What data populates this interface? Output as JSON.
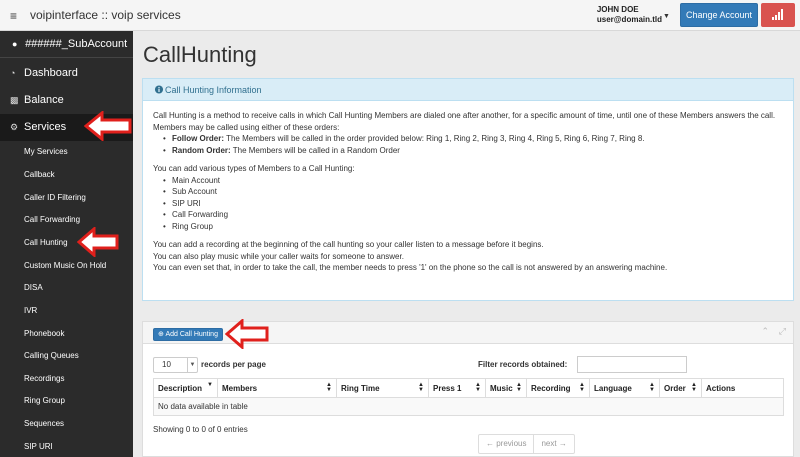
{
  "topbar": {
    "app_title": "voipinterface :: voip services",
    "user_name": "JOHN DOE",
    "user_email": "user@domain.tld",
    "change_account_label": "Change Account"
  },
  "sidebar": {
    "account": "######_SubAccount",
    "main_items": [
      {
        "label": "Dashboard",
        "icon": "dashboard-icon"
      },
      {
        "label": "Balance",
        "icon": "bar-chart-icon"
      },
      {
        "label": "Services",
        "icon": "gear-icon",
        "active": true
      }
    ],
    "sub_items": [
      "My Services",
      "Callback",
      "Caller ID Filtering",
      "Call Forwarding",
      "Call Hunting",
      "Custom Music On Hold",
      "DISA",
      "IVR",
      "Phonebook",
      "Calling Queues",
      "Recordings",
      "Ring Group",
      "Sequences",
      "SIP URI"
    ]
  },
  "main": {
    "page_title": "CallHunting",
    "info_panel": {
      "title": "Call Hunting Information",
      "intro": "Call Hunting is a method to receive calls in which Call Hunting Members are dialed one after another, for a specific amount of time, until one of these Members answers the call.",
      "orders_intro": "Members may be called using either of these orders:",
      "follow_label": "Follow Order:",
      "follow_text": " The Members will be called in the order provided below: Ring 1, Ring 2, Ring 3, Ring 4, Ring 5, Ring 6, Ring 7, Ring 8.",
      "random_label": "Random Order:",
      "random_text": " The Members will be called in a Random Order",
      "types_intro": "You can add various types of Members to a Call Hunting:",
      "types": [
        "Main Account",
        "Sub Account",
        "SIP URI",
        "Call Forwarding",
        "Ring Group"
      ],
      "notes": [
        "You can add a recording at the beginning of the call hunting so your caller listen to a message before it begins.",
        "You can also play music while your caller waits for someone to answer.",
        "You can even set that, in order to take the call, the member needs to press '1' on the phone so the call is not answered by an answering machine."
      ]
    },
    "list_panel": {
      "add_button": "Add Call Hunting",
      "page_length": "10",
      "length_label": "records per page",
      "filter_label": "Filter records obtained:",
      "filter_value": "",
      "columns": [
        "Description",
        "Members",
        "Ring Time",
        "Press 1",
        "Music",
        "Recording",
        "Language",
        "Order",
        "Actions"
      ],
      "empty_message": "No data available in table",
      "info": "Showing 0 to 0 of 0 entries",
      "prev_label": "← previous",
      "next_label": "next →"
    }
  },
  "colors": {
    "primary": "#337ab7",
    "danger": "#d9534f",
    "sidebar_bg": "#2b2b2b",
    "info_bg": "#d9edf7",
    "annotation_arrow": "#e0201c"
  }
}
